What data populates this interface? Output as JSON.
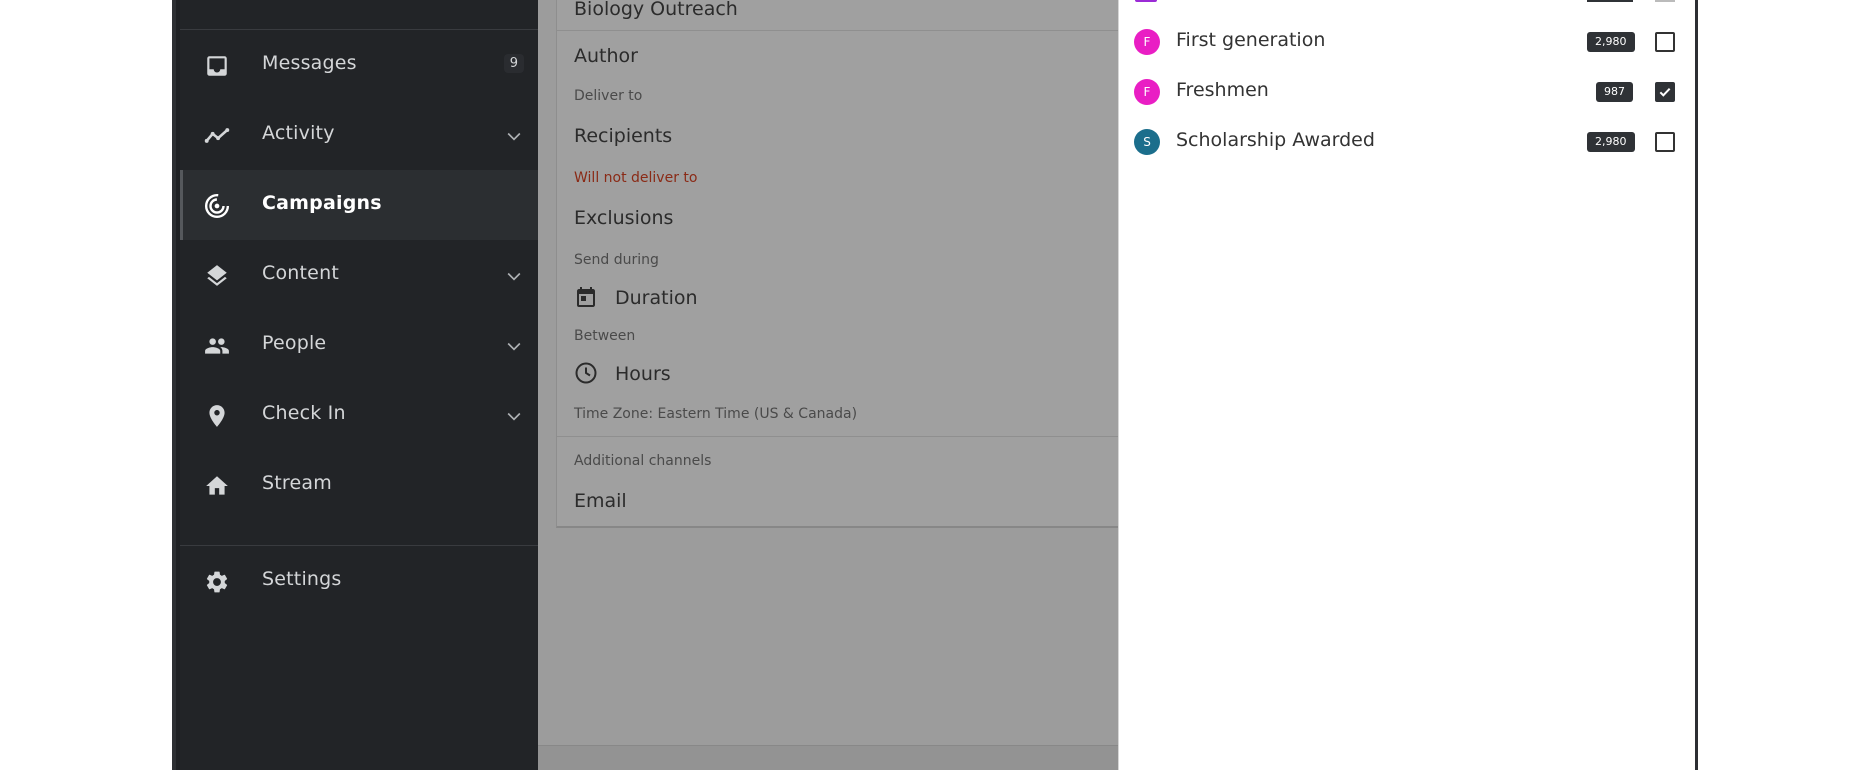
{
  "colors": {
    "sidebar_bg": "#222427",
    "active_item_bg": "#2b2e31",
    "overlay_main": "#9c9c9c",
    "warning_text": "#8a2a16",
    "avatar_pink": "#e91ec4",
    "avatar_teal": "#1b6e8c",
    "count_badge": "#2f3236"
  },
  "sidebar": {
    "items": [
      {
        "label": "Messages",
        "icon": "inbox-icon",
        "badge": "9"
      },
      {
        "label": "Activity",
        "icon": "activity-chart-icon"
      },
      {
        "label": "Campaigns",
        "icon": "campaign-target-icon"
      },
      {
        "label": "Content",
        "icon": "layers-icon"
      },
      {
        "label": "People",
        "icon": "people-icon"
      },
      {
        "label": "Check In",
        "icon": "location-pin-icon"
      },
      {
        "label": "Stream",
        "icon": "home-icon"
      }
    ],
    "settings_label": "Settings"
  },
  "main": {
    "campaign_name": "Biology Outreach",
    "author_label": "Author",
    "deliver_to_label": "Deliver to",
    "recipients_label": "Recipients",
    "will_not_deliver_label": "Will not deliver to",
    "exclusions_label": "Exclusions",
    "send_during_label": "Send during",
    "duration_label": "Duration",
    "between_label": "Between",
    "hours_label": "Hours",
    "timezone_text": "Time Zone: Eastern Time (US & Canada)",
    "additional_channels_label": "Additional channels",
    "email_label": "Email"
  },
  "segments": [
    {
      "initial": "F",
      "label": "First generation",
      "count": "2,980",
      "checked": false,
      "color": "#e91ec4"
    },
    {
      "initial": "F",
      "label": "Freshmen",
      "count": "987",
      "checked": true,
      "color": "#e91ec4"
    },
    {
      "initial": "S",
      "label": "Scholarship Awarded",
      "count": "2,980",
      "checked": false,
      "color": "#1b6e8c"
    }
  ]
}
